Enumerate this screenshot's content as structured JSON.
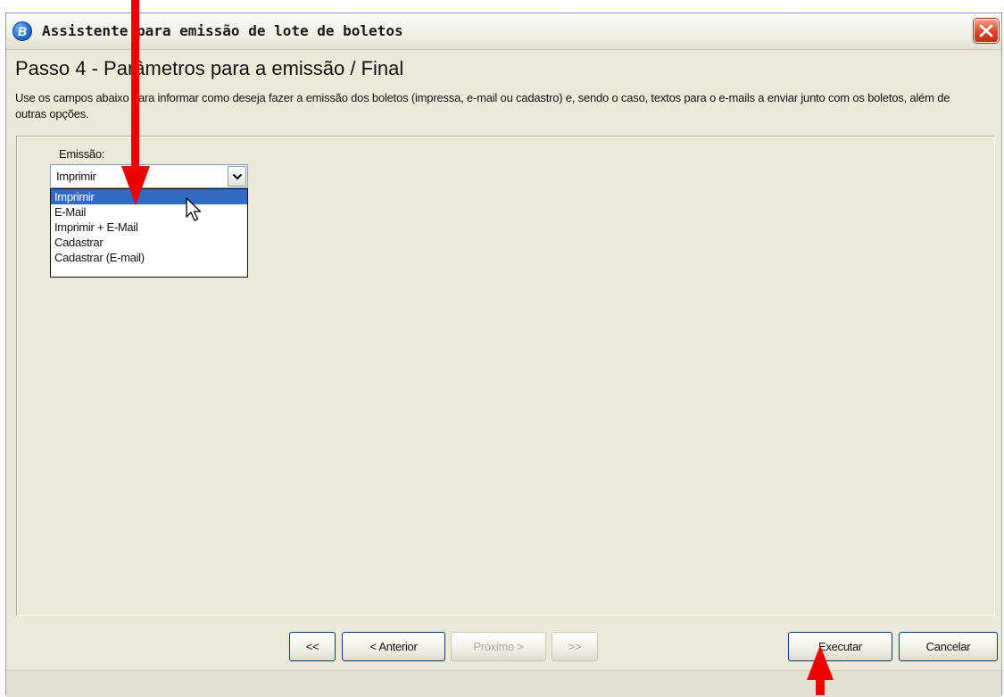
{
  "window": {
    "title": "Assistente para emissão de lote de boletos",
    "app_icon_letter": "B",
    "close_icon": "close-x-icon"
  },
  "header": {
    "step_title": "Passo 4 - Parâmetros para a emissão / Final",
    "description": "Use os campos abaixo para informar como deseja fazer a emissão dos boletos (impressa, e-mail ou cadastro) e, sendo o caso, textos para o e-mails a enviar junto com os boletos, além de outras opções."
  },
  "emissao": {
    "label": "Emissão:",
    "selected": "Imprimir",
    "options": [
      "Imprimir",
      "E-Mail",
      "Imprimir + E-Mail",
      "Cadastrar",
      "Cadastrar (E-mail)"
    ],
    "highlighted_index": 0
  },
  "buttons": {
    "first": "<<",
    "prev": "< Anterior",
    "next": "Próximo >",
    "last": ">>",
    "execute": "Executar",
    "cancel": "Cancelar"
  },
  "colors": {
    "annotation_arrow": "#ee0000",
    "selection": "#316ac5",
    "close_button": "#d8452a"
  }
}
